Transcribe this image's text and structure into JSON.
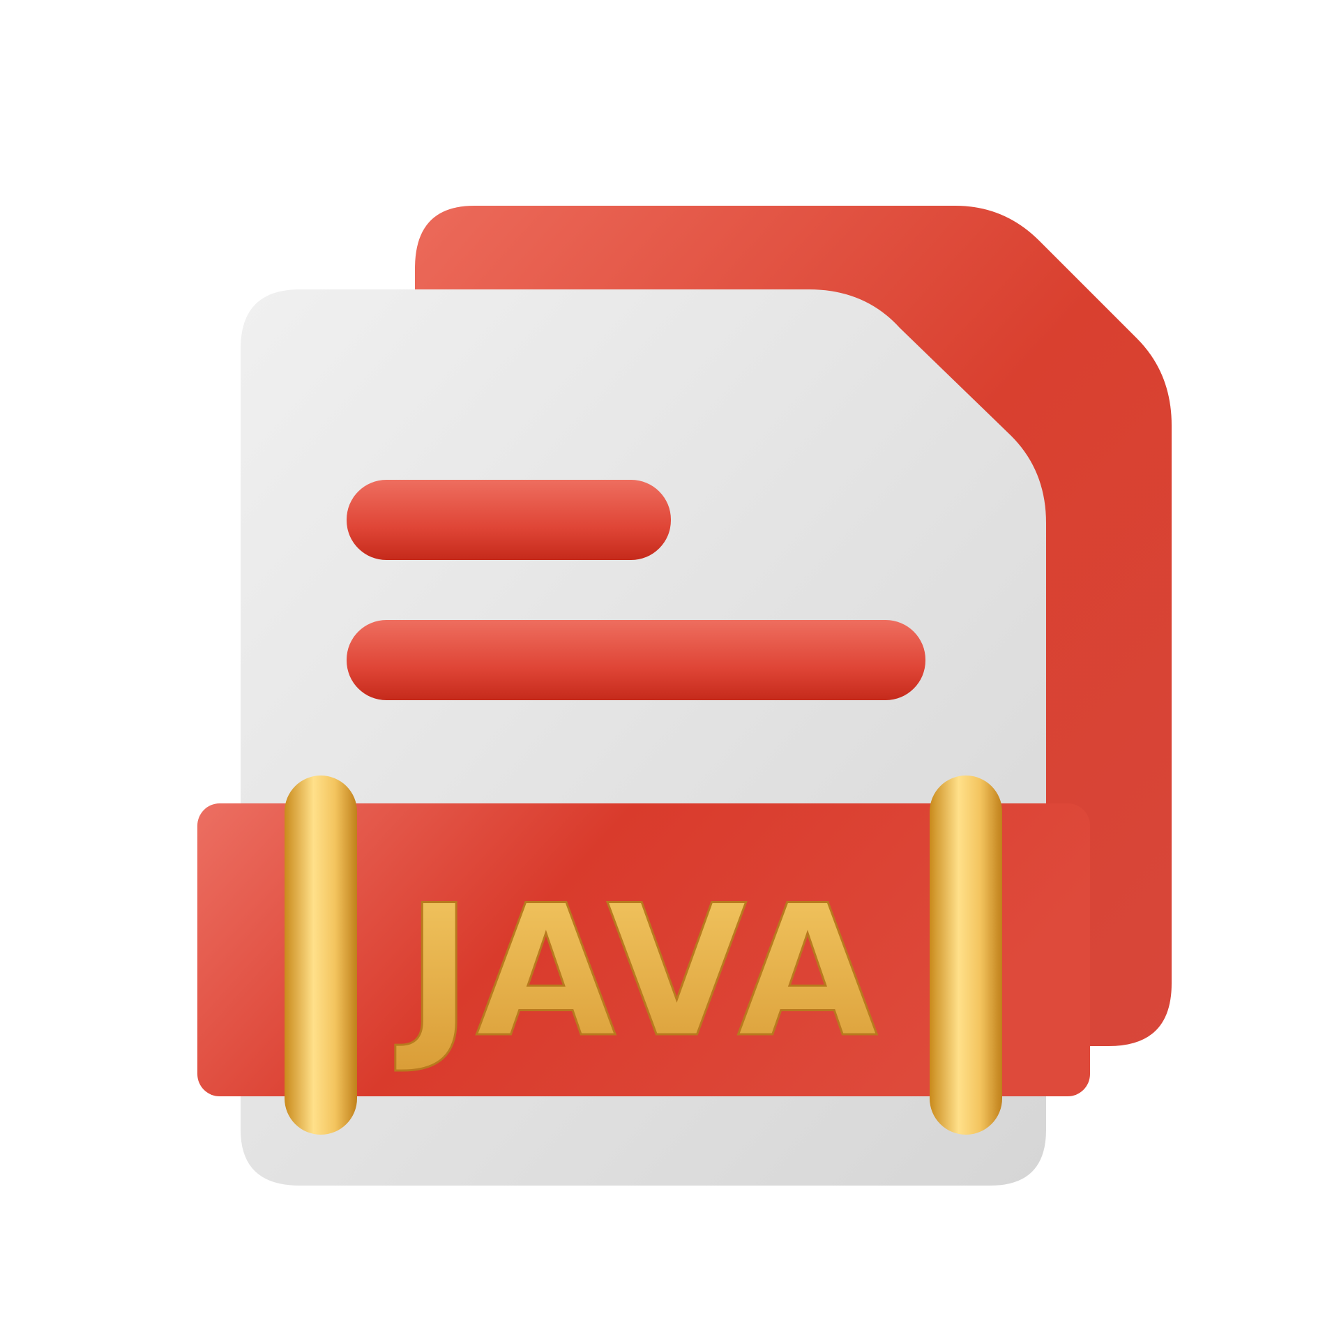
{
  "file_icon": {
    "extension_label": "JAVA",
    "icon_name": "java-file-icon",
    "colors": {
      "background": "#ffffff",
      "back_sheet": "#dc4535",
      "front_sheet": "#e2e2e2",
      "banner": "#dc4233",
      "text_lines": "#e0483a",
      "gold": "#e6b04c"
    }
  }
}
